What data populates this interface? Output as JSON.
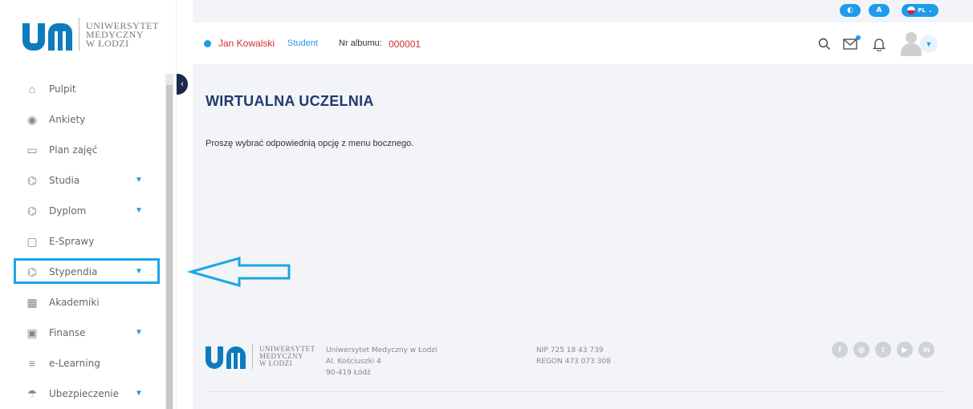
{
  "topbar": {
    "contrast_label": "◐",
    "font_label": "A",
    "lang_label": "PL"
  },
  "sidebar": {
    "logo": {
      "line1": "UNIWERSYTET",
      "line2": "MEDYCZNY",
      "line3": "W ŁODZI"
    },
    "items": [
      {
        "label": "Pulpit",
        "icon": "home-icon"
      },
      {
        "label": "Ankiety",
        "icon": "radio-icon"
      },
      {
        "label": "Plan zajęć",
        "icon": "calendar-icon"
      },
      {
        "label": "Studia",
        "icon": "graduation-cap-icon",
        "expandable": true
      },
      {
        "label": "Dyplom",
        "icon": "graduation-cap-icon",
        "expandable": true
      },
      {
        "label": "E-Sprawy",
        "icon": "chat-bubble-icon"
      },
      {
        "label": "Stypendia",
        "icon": "graduation-cap-icon",
        "expandable": true,
        "highlighted": true
      },
      {
        "label": "Akademiki",
        "icon": "building-icon"
      },
      {
        "label": "Finanse",
        "icon": "banknote-icon",
        "expandable": true
      },
      {
        "label": "e-Learning",
        "icon": "menu-lines-icon"
      },
      {
        "label": "Ubezpieczenie",
        "icon": "umbrella-icon",
        "expandable": true
      }
    ]
  },
  "header": {
    "user_name": "Jan Kowalski",
    "user_role": "Student",
    "album_label": "Nr albumu:",
    "album_number": "000001"
  },
  "main": {
    "title": "WIRTUALNA UCZELNIA",
    "message": "Proszę wybrać odpowiednią opcję z menu bocznego."
  },
  "footer": {
    "logo": {
      "line1": "UNIWERSYTET",
      "line2": "MEDYCZNY",
      "line3": "W ŁODZI"
    },
    "address": [
      "Uniwersytet Medyczny w Łodzi",
      "Al. Kościuszki 4",
      "90-419 Łódź"
    ],
    "tax": [
      "NIP 725 18 43 739",
      "REGON 473 073 308"
    ],
    "socials": [
      "f",
      "◎",
      "t",
      "▶",
      "in"
    ]
  },
  "colors": {
    "accent": "#1e9bea",
    "title": "#1f3a6e",
    "user_red": "#d32f2f",
    "highlight": "#1aa6e6"
  }
}
